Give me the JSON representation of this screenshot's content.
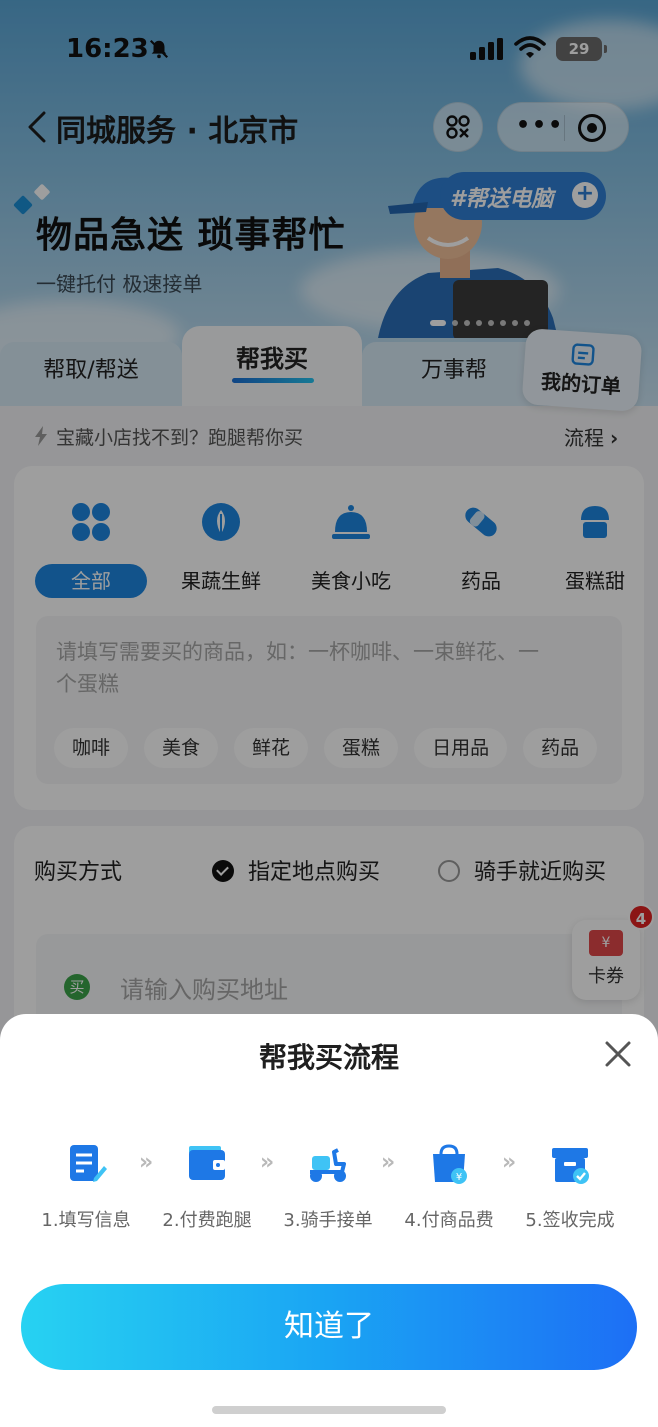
{
  "status_bar": {
    "time": "16:23",
    "battery": "29"
  },
  "navbar": {
    "title": "同城服务 · 北京市"
  },
  "hero": {
    "title": "物品急送 琐事帮忙",
    "subtitle": "一键托付 极速接单",
    "tag": "#帮送电脑"
  },
  "tabs": [
    {
      "label": "帮取/帮送"
    },
    {
      "label": "帮我买"
    },
    {
      "label": "万事帮"
    }
  ],
  "my_orders": "我的订单",
  "tip": {
    "text": "宝藏小店找不到？跑腿帮你买",
    "link": "流程"
  },
  "categories": [
    {
      "label": "全部",
      "icon": "grid-icon"
    },
    {
      "label": "果蔬生鲜",
      "icon": "produce-icon"
    },
    {
      "label": "美食小吃",
      "icon": "dish-cover-icon"
    },
    {
      "label": "药品",
      "icon": "pill-icon"
    },
    {
      "label": "蛋糕甜",
      "icon": "cake-icon"
    }
  ],
  "goods_input": {
    "placeholder": "请填写需要买的商品，如：一杯咖啡、一束鲜花、一个蛋糕",
    "chips": [
      "咖啡",
      "美食",
      "鲜花",
      "蛋糕",
      "日用品",
      "药品"
    ]
  },
  "purchase": {
    "label": "购买方式",
    "option_1": "指定地点购买",
    "option_2": "骑手就近购买",
    "address_badge": "买",
    "address_placeholder": "请输入购买地址"
  },
  "coupon": {
    "label": "卡券",
    "count": "4",
    "icon_text": "¥"
  },
  "sheet": {
    "title": "帮我买流程",
    "steps": [
      {
        "label": "1.填写信息",
        "icon": "form-edit-icon"
      },
      {
        "label": "2.付费跑腿",
        "icon": "wallet-icon"
      },
      {
        "label": "3.骑手接单",
        "icon": "scooter-icon"
      },
      {
        "label": "4.付商品费",
        "icon": "shopping-bag-icon"
      },
      {
        "label": "5.签收完成",
        "icon": "box-check-icon"
      }
    ],
    "arrow": "»",
    "button": "知道了"
  },
  "colors": {
    "accent": "#1d86e0",
    "button_start": "#27d2f2",
    "button_end": "#1d6ff5",
    "badge_red": "#e02323"
  }
}
